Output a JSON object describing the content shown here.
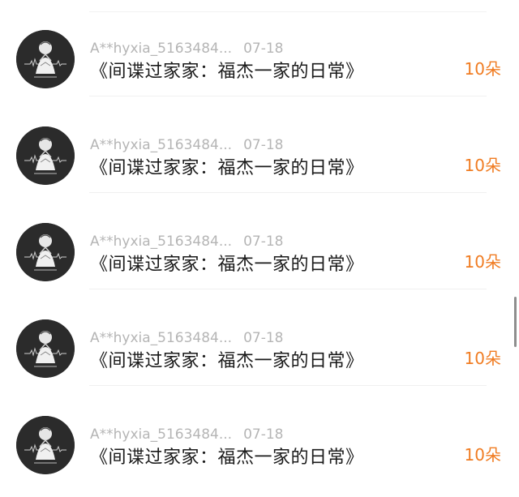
{
  "list": {
    "items": [
      {
        "username": "A**hyxia_5163484...",
        "date": "07-18",
        "title": "《间谍过家家：福杰一家的日常》",
        "amount": "10朵"
      },
      {
        "username": "A**hyxia_5163484...",
        "date": "07-18",
        "title": "《间谍过家家：福杰一家的日常》",
        "amount": "10朵"
      },
      {
        "username": "A**hyxia_5163484...",
        "date": "07-18",
        "title": "《间谍过家家：福杰一家的日常》",
        "amount": "10朵"
      },
      {
        "username": "A**hyxia_5163484...",
        "date": "07-18",
        "title": "《间谍过家家：福杰一家的日常》",
        "amount": "10朵"
      },
      {
        "username": "A**hyxia_5163484...",
        "date": "07-18",
        "title": "《间谍过家家：福杰一家的日常》",
        "amount": "10朵"
      }
    ]
  },
  "colors": {
    "amount": "#f07c22",
    "meta": "#b5b5b5",
    "title": "#1a1a1a",
    "avatar_bg": "#2b2b2b"
  },
  "icons": {
    "avatar": "avatar-icon"
  }
}
